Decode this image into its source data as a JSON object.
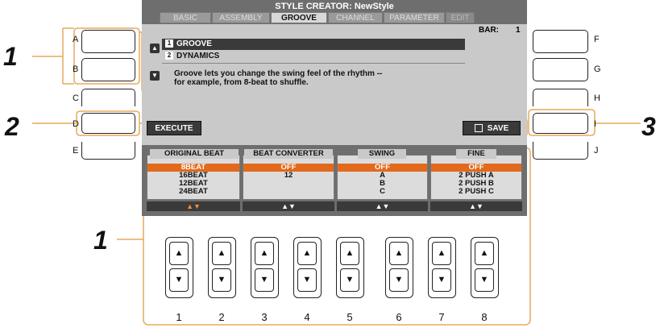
{
  "screen": {
    "title": "STYLE CREATOR: NewStyle",
    "tabs": [
      {
        "label": "BASIC"
      },
      {
        "label": "ASSEMBLY"
      },
      {
        "label": "GROOVE"
      },
      {
        "label": "CHANNEL"
      },
      {
        "label": "PARAMETER"
      },
      {
        "label": "EDIT"
      }
    ],
    "bar_label": "BAR:",
    "bar_value": "1",
    "list": [
      {
        "num": "1",
        "label": "GROOVE"
      },
      {
        "num": "2",
        "label": "DYNAMICS"
      }
    ],
    "description_line1": "Groove lets you change the swing feel of the rhythm --",
    "description_line2": "for example, from 8-beat to shuffle.",
    "execute_label": "EXECUTE",
    "save_label": "SAVE",
    "columns": [
      {
        "header": "ORIGINAL BEAT",
        "options": [
          "8BEAT",
          "16BEAT",
          "12BEAT",
          "24BEAT"
        ],
        "selected": 0
      },
      {
        "header": "BEAT CONVERTER",
        "options": [
          "OFF",
          "12"
        ],
        "selected": 0
      },
      {
        "header": "SWING",
        "options": [
          "OFF",
          "A",
          "B",
          "C"
        ],
        "selected": 0
      },
      {
        "header": "FINE",
        "options": [
          "OFF",
          "2 PUSH A",
          "2 PUSH B",
          "2 PUSH C"
        ],
        "selected": 0
      }
    ],
    "arrows": "▲▼"
  },
  "side_buttons_left": [
    "A",
    "B",
    "C",
    "D",
    "E"
  ],
  "side_buttons_right": [
    "F",
    "G",
    "H",
    "I",
    "J"
  ],
  "knob_numbers": [
    "1",
    "2",
    "3",
    "4",
    "5",
    "6",
    "7",
    "8"
  ],
  "callouts": [
    "1",
    "2",
    "1",
    "3"
  ],
  "colors": {
    "accent": "#e26a1c",
    "callout_line": "#e8a95a"
  }
}
